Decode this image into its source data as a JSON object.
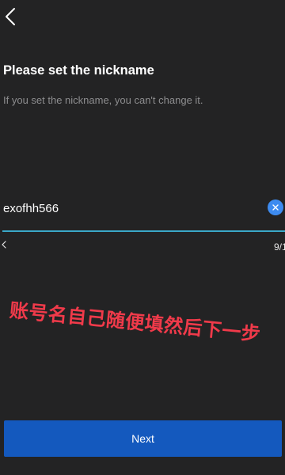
{
  "header": {
    "back_icon": "chevron-left-icon"
  },
  "form": {
    "title": "Please set the nickname",
    "subtitle": "If you set the nickname, you can't change it.",
    "nickname_value": "exofhh566",
    "clear_icon": "close-icon",
    "scroll_icon": "chevron-left-icon",
    "counter": "9/1"
  },
  "overlay": {
    "caption": "账号名自己随便填然后下一步",
    "color": "#f03a4a"
  },
  "footer": {
    "next_label": "Next",
    "button_color": "#1459be"
  },
  "theme": {
    "background": "#232324",
    "accent": "#3aa8c8",
    "clear_button_color": "#3d8bf0"
  }
}
